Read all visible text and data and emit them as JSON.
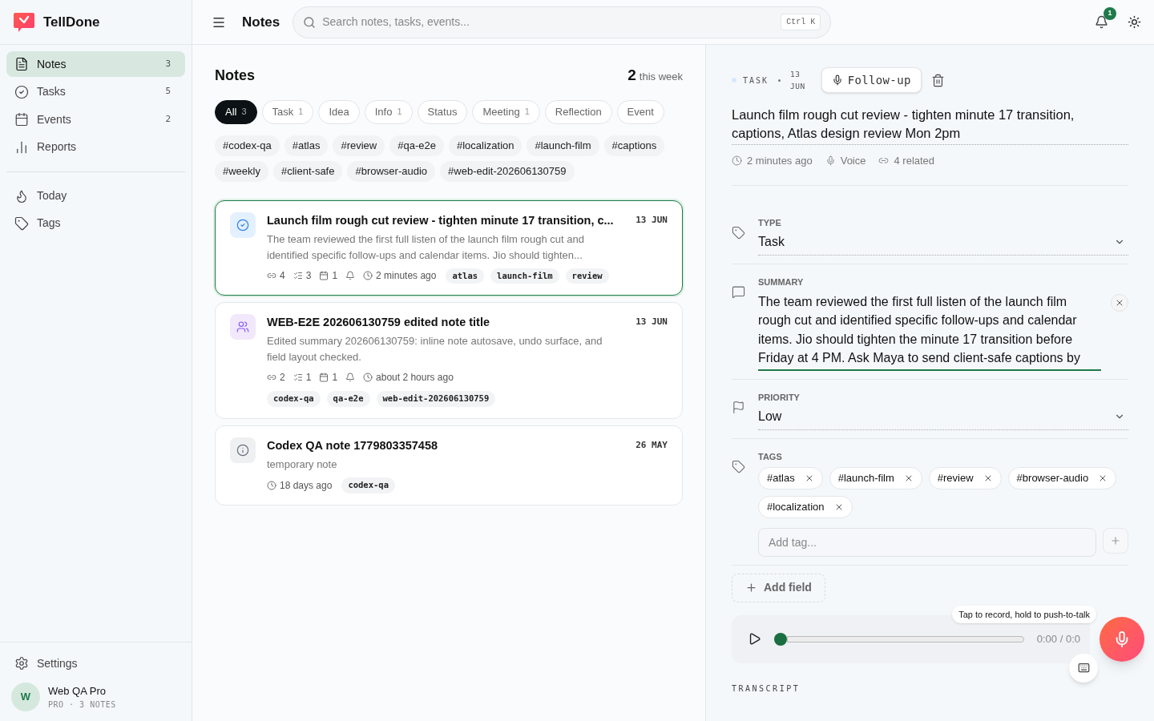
{
  "sidebar": {
    "brand": "TellDone",
    "nav": [
      {
        "label": "Notes",
        "count": "3",
        "selected": true
      },
      {
        "label": "Tasks",
        "count": "5",
        "selected": false
      },
      {
        "label": "Events",
        "count": "2",
        "selected": false
      },
      {
        "label": "Reports",
        "selected": false
      }
    ],
    "secondary": [
      {
        "label": "Today",
        "selected": false
      },
      {
        "label": "Tags",
        "selected": false
      }
    ],
    "settings": "Settings",
    "user": {
      "initial": "W",
      "name": "Web QA Pro",
      "plan": "PRO · 3 NOTES"
    }
  },
  "header": {
    "title": "Notes",
    "search_placeholder": "Search notes, tasks, events...",
    "shortcut": [
      "Ctrl",
      "K"
    ],
    "notification_count": "1"
  },
  "list": {
    "title": "Notes",
    "week_count": "2",
    "week_label": "this week",
    "filters": [
      {
        "label": "All",
        "count": "3",
        "selected": true
      },
      {
        "label": "Task",
        "count": "1",
        "selected": false
      },
      {
        "label": "Idea",
        "selected": false
      },
      {
        "label": "Info",
        "count": "1",
        "selected": false
      },
      {
        "label": "Status",
        "selected": false
      },
      {
        "label": "Meeting",
        "count": "1",
        "selected": false
      },
      {
        "label": "Reflection",
        "selected": false
      },
      {
        "label": "Event",
        "selected": false
      }
    ],
    "tags": [
      "#codex-qa",
      "#atlas",
      "#review",
      "#qa-e2e",
      "#localization",
      "#launch-film",
      "#captions",
      "#weekly",
      "#client-safe",
      "#browser-audio",
      "#web-edit-202606130759"
    ],
    "notes": [
      {
        "kind": "task",
        "selected": true,
        "title": "Launch film rough cut review - tighten minute 17 transition, c...",
        "date": "13 JUN",
        "summary": "The team reviewed the first full listen of the launch film rough cut and identified specific follow-ups and calendar items. Jio should tighten...",
        "links": "4",
        "subtasks": "3",
        "events": "1",
        "reminder": true,
        "time": "2 minutes ago",
        "tags": [
          "atlas",
          "launch-film",
          "review"
        ]
      },
      {
        "kind": "meeting",
        "selected": false,
        "title": "WEB-E2E 202606130759 edited note title",
        "date": "13 JUN",
        "summary": "Edited summary 202606130759: inline note autosave, undo surface, and field layout checked.",
        "links": "2",
        "subtasks": "1",
        "events": "1",
        "reminder": true,
        "time": "about 2 hours ago",
        "tags": [
          "codex-qa",
          "qa-e2e",
          "web-edit-202606130759"
        ]
      },
      {
        "kind": "info",
        "selected": false,
        "title": "Codex QA note 1779803357458",
        "date": "26 MAY",
        "summary": "temporary note",
        "reminder": false,
        "time": "18 days ago",
        "tags": [
          "codex-qa"
        ]
      }
    ]
  },
  "detail": {
    "type_label": "TASK",
    "date_lines": [
      "13",
      "JUN"
    ],
    "follow_up": "Follow-up",
    "title": "Launch film rough cut review - tighten minute 17 transition, captions, Atlas design review Mon 2pm",
    "meta": [
      {
        "kind": "time",
        "text": "2 minutes ago"
      },
      {
        "kind": "voice",
        "text": "Voice"
      },
      {
        "kind": "related",
        "text": "4 related"
      }
    ],
    "fields": [
      {
        "kind": "select",
        "label": "TYPE",
        "value": "Task"
      },
      {
        "kind": "text",
        "label": "SUMMARY",
        "value": "The team reviewed the first full listen of the launch film rough cut and identified specific follow-ups and calendar items. Jio should tighten the minute 17 transition before Friday at 4 PM. Ask Maya to send client-safe captions by"
      },
      {
        "kind": "select",
        "label": "PRIORITY",
        "value": "Low"
      },
      {
        "kind": "tags",
        "label": "TAGS",
        "tags": [
          "#atlas",
          "#launch-film",
          "#review",
          "#browser-audio",
          "#localization"
        ],
        "placeholder": "Add tag..."
      }
    ],
    "add_field": "Add field",
    "player": {
      "time": "0:00 / 0:0",
      "level": 0
    },
    "tooltip": "Tap to record, hold to push-to-talk",
    "transcript_label": "TRANSCRIPT"
  }
}
